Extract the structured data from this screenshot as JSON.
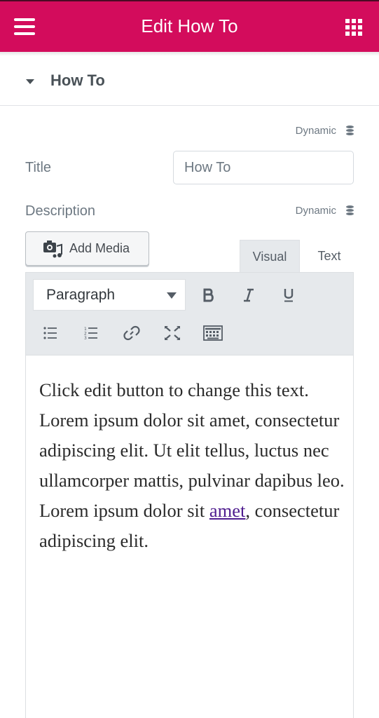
{
  "header": {
    "title": "Edit How To"
  },
  "section": {
    "title": "How To"
  },
  "dynamic_label": "Dynamic",
  "fields": {
    "title_label": "Title",
    "title_value": "How To",
    "description_label": "Description"
  },
  "editor": {
    "add_media_label": "Add Media",
    "tabs": {
      "visual": "Visual",
      "text": "Text"
    },
    "format_value": "Paragraph",
    "content_before_link": "Click edit button to change this text. Lorem ipsum dolor sit amet, consectetur adipiscing elit. Ut elit tellus, luctus nec ullamcorper mattis, pulvinar dapibus leo. Lorem ipsum dolor sit ",
    "content_link": "amet",
    "content_after_link": ", consectetur adipiscing elit."
  },
  "colors": {
    "header_bg": "#d30c5c",
    "link": "#4f1d8f",
    "toolbar_bg": "#e6e9ec"
  }
}
